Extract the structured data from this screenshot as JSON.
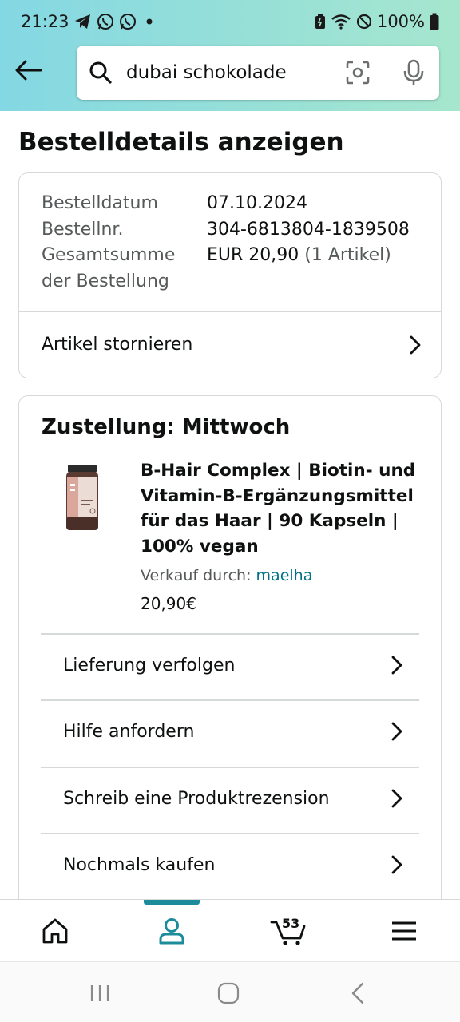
{
  "status_bar": {
    "time": "21:23",
    "battery": "100%",
    "left_icons": [
      "telegram-icon",
      "whatsapp-icon",
      "whatsapp-icon",
      "dot-icon"
    ],
    "right_icons": [
      "battery-saver-icon",
      "wifi-icon",
      "do-not-disturb-icon",
      "battery-icon"
    ]
  },
  "header": {
    "search_value": "dubai schokolade",
    "colors": {
      "gradient_start": "#84d8e3",
      "gradient_end": "#a6e6ce"
    }
  },
  "page": {
    "title": "Bestelldetails anzeigen"
  },
  "order_summary": {
    "date_label": "Bestelldatum",
    "date_value": "07.10.2024",
    "number_label": "Bestellnr.",
    "number_value": "304-6813804-1839508",
    "total_label_line1": "Gesamtsumme",
    "total_label_line2": "der Bestellung",
    "total_value": "EUR 20,90",
    "total_items": "(1 Artikel)",
    "cancel_link": "Artikel stornieren"
  },
  "delivery": {
    "title": "Zustellung: Mittwoch",
    "product": {
      "title": "B-Hair Complex | Biotin- und Vitamin-B-Ergänzungsmittel für das Haar | 90 Kapseln | 100% vegan",
      "seller_prefix": "Verkauf durch: ",
      "seller_name": "maelha",
      "price": "20,90€",
      "image_label": "maelha"
    },
    "actions": [
      {
        "label": "Lieferung verfolgen"
      },
      {
        "label": "Hilfe anfordern"
      },
      {
        "label": "Schreib eine Produktrezension"
      },
      {
        "label": "Nochmals kaufen"
      }
    ]
  },
  "bottom_nav": {
    "items": [
      "home-icon",
      "account-icon",
      "cart-icon",
      "menu-icon"
    ],
    "cart_count": "53",
    "active": "account-icon",
    "accent": "#1d8c9a"
  },
  "system_nav": {
    "items": [
      "recents-icon",
      "home-circle-icon",
      "back-chevron-icon"
    ]
  }
}
